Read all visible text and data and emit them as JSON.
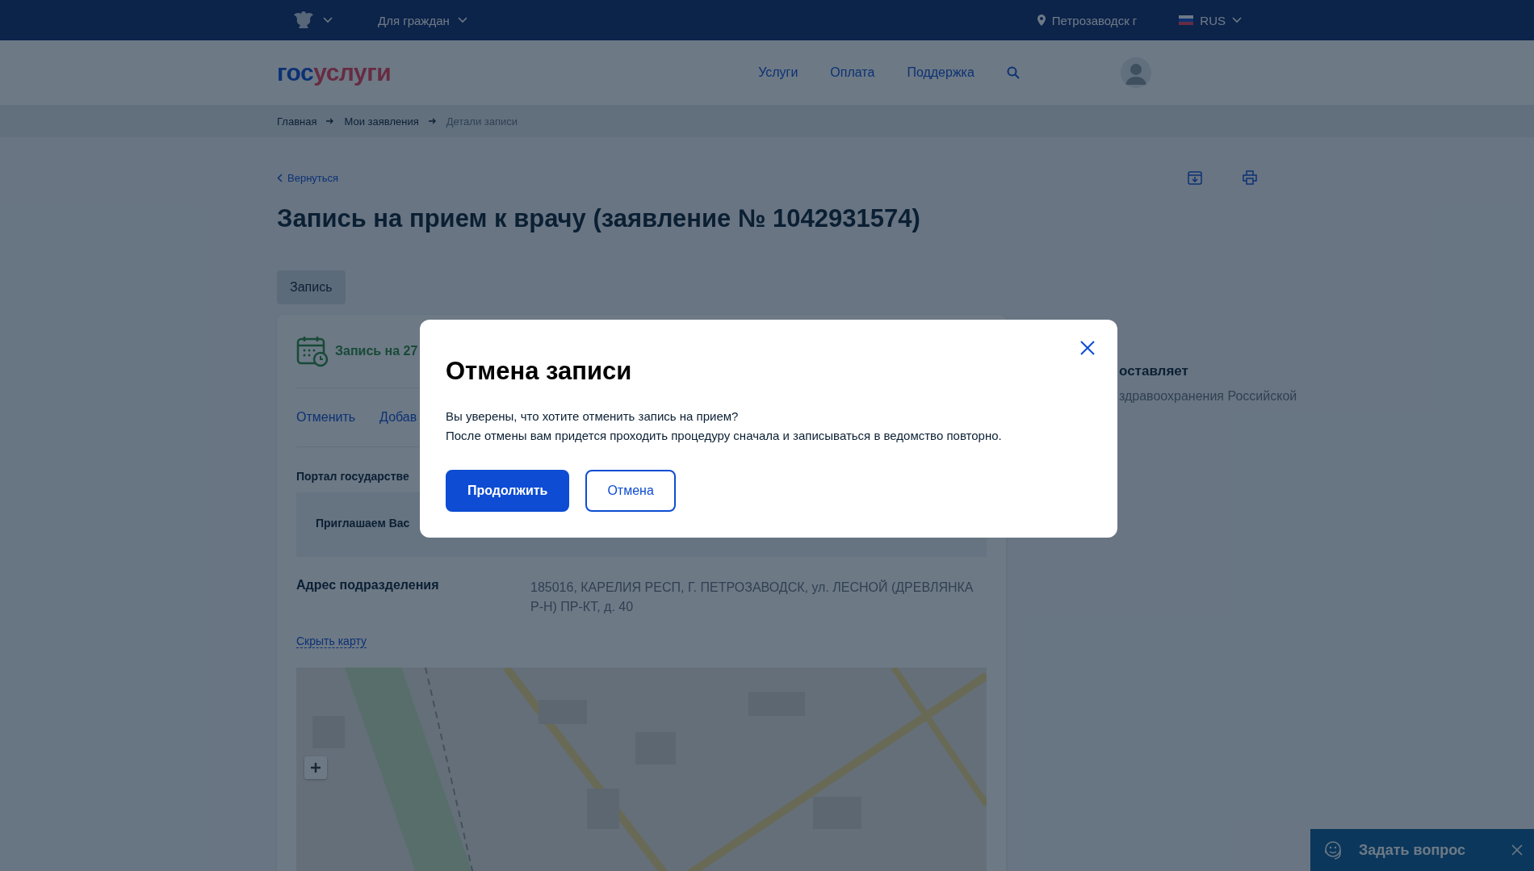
{
  "top_bar": {
    "menu": "Для граждан",
    "location": "Петрозаводск г",
    "language": "RUS"
  },
  "header": {
    "logo": {
      "prefix": "гос",
      "suffix": "услуги"
    },
    "nav": [
      {
        "label": "Услуги"
      },
      {
        "label": "Оплата"
      },
      {
        "label": "Поддержка"
      }
    ]
  },
  "breadcrumbs": [
    {
      "label": "Главная",
      "current": false
    },
    {
      "label": "Мои заявления",
      "current": false
    },
    {
      "label": "Детали записи",
      "current": true
    }
  ],
  "back_link": "Вернуться",
  "title": "Запись на прием к врачу (заявление № 1042931574)",
  "tabs": [
    {
      "label": "Запись",
      "selected": true
    }
  ],
  "card": {
    "heading": "Запись на 27",
    "actions": [
      "Отменить",
      "Добав"
    ],
    "source": "Портал государстве",
    "notice": "Приглашаем Вас",
    "address_label": "Адрес подразделения",
    "address": "185016, КАРЕЛИЯ РЕСП, Г. ПЕТРОЗАВОДСК, ул. ЛЕСНОЙ (ДРЕВЛЯНКА Р-Н) ПР-КТ, д. 40",
    "map_toggle": "Скрыть карту"
  },
  "side": {
    "heading": "оставляет",
    "text": "здравоохранения Российской"
  },
  "modal": {
    "title": "Отмена записи",
    "lines": [
      "Вы уверены, что хотите отменить запись на прием?",
      "После отмены вам придется проходить процедуру сначала и записываться в ведомство повторно."
    ],
    "buttons": [
      {
        "label": "Продолжить",
        "kind": "primary"
      },
      {
        "label": "Отмена",
        "kind": "secondary"
      }
    ]
  },
  "chat": {
    "label": "Задать вопрос"
  }
}
